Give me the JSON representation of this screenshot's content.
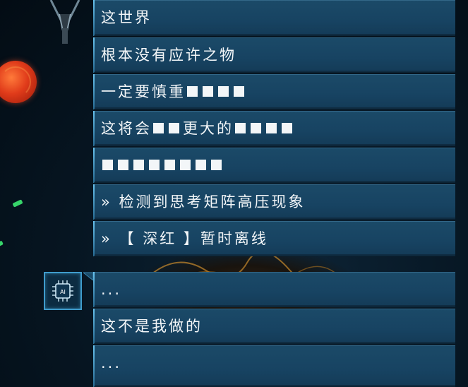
{
  "dialogue": {
    "upper": [
      {
        "text": "这世界"
      },
      {
        "text": "根本没有应许之物"
      },
      {
        "text": "一定要慎重",
        "squares": 4
      },
      {
        "prefix": "这将会",
        "mid_squares": 2,
        "mid": "更大的",
        "squares": 4
      },
      {
        "text": "",
        "squares": 8
      },
      {
        "text": "» 检测到思考矩阵高压现象"
      },
      {
        "text": "» 【 深红 】暂时离线"
      }
    ],
    "lower": [
      {
        "text": "..."
      },
      {
        "text": "这不是我做的"
      },
      {
        "text": "..."
      }
    ]
  },
  "avatar": {
    "label": "AI",
    "icon": "chip-icon"
  },
  "colors": {
    "panel": "#174362",
    "accent": "#3a86b0",
    "text": "#f3f6f8"
  }
}
